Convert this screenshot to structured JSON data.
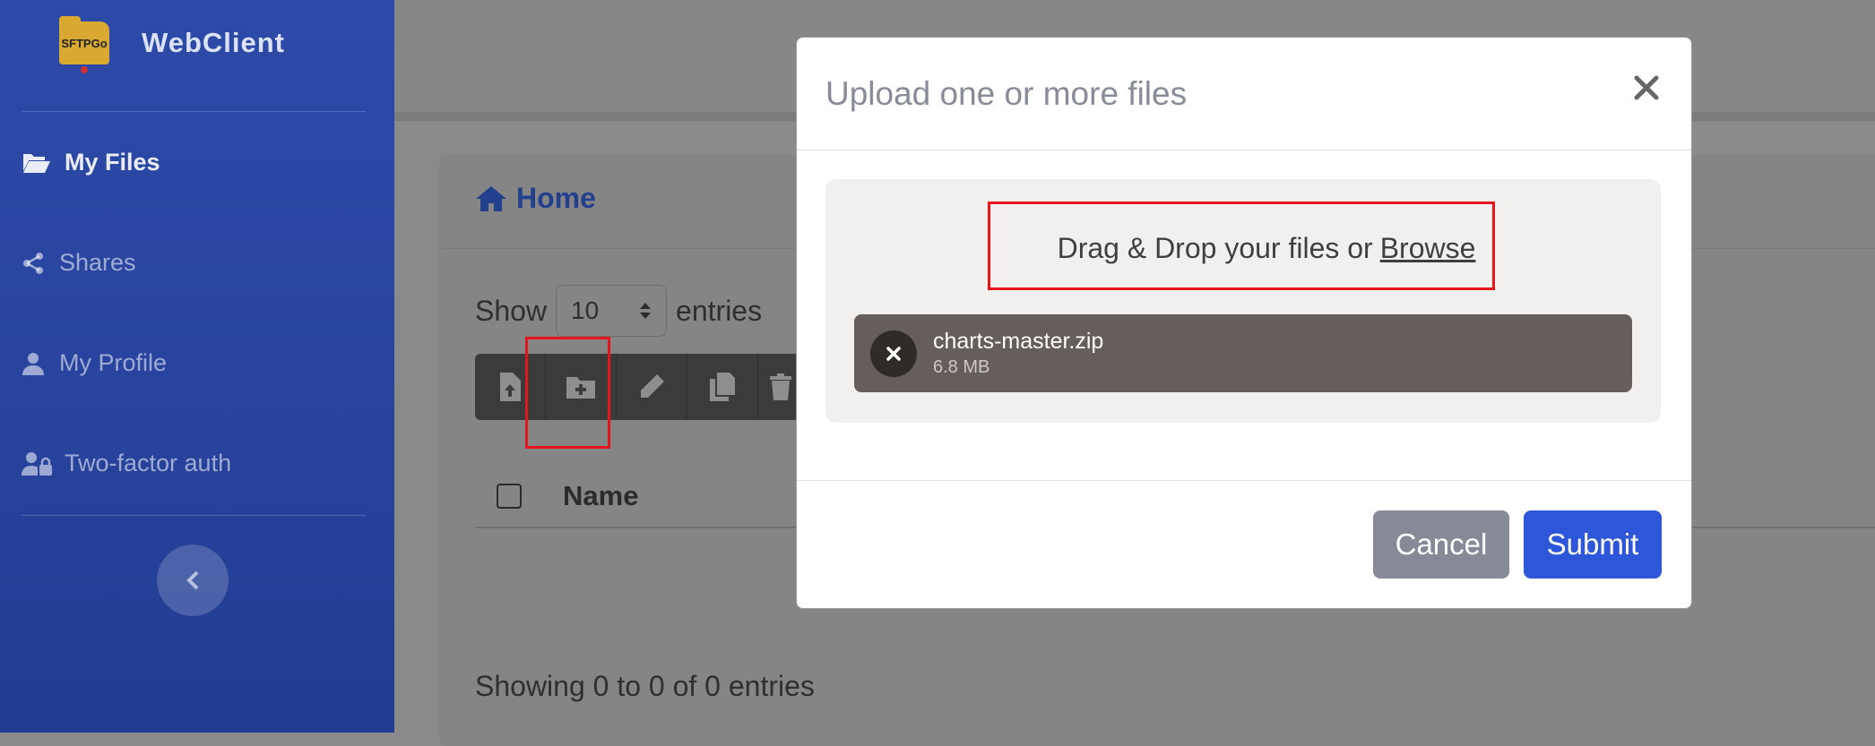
{
  "brand": {
    "logo_text": "SFTPGo",
    "name": "WebClient"
  },
  "sidebar": {
    "items": [
      {
        "label": "My Files",
        "icon": "folder-open-icon",
        "active": true
      },
      {
        "label": "Shares",
        "icon": "share-icon",
        "active": false
      },
      {
        "label": "My Profile",
        "icon": "user-icon",
        "active": false
      },
      {
        "label": "Two-factor auth",
        "icon": "user-lock-icon",
        "active": false
      }
    ],
    "collapse_icon": "chevron-left-icon"
  },
  "main": {
    "title": "Home",
    "show_label": "Show",
    "entries_value": "10",
    "entries_label": "entries",
    "table": {
      "columns": [
        "Name"
      ]
    },
    "footer_text": "Showing 0 to 0 of 0 entries",
    "toolbar_icons": [
      "upload-file-icon",
      "add-folder-icon",
      "rename-icon",
      "copy-icon",
      "delete-icon"
    ]
  },
  "modal": {
    "title": "Upload one or more files",
    "drop_text": "Drag & Drop your files or",
    "browse_label": "Browse",
    "files": [
      {
        "name": "charts-master.zip",
        "size": "6.8 MB"
      }
    ],
    "cancel_label": "Cancel",
    "submit_label": "Submit"
  },
  "colors": {
    "sidebar": "#2d4aa8",
    "primary": "#2e56d8",
    "secondary": "#858a96",
    "highlight": "#e5151c"
  }
}
